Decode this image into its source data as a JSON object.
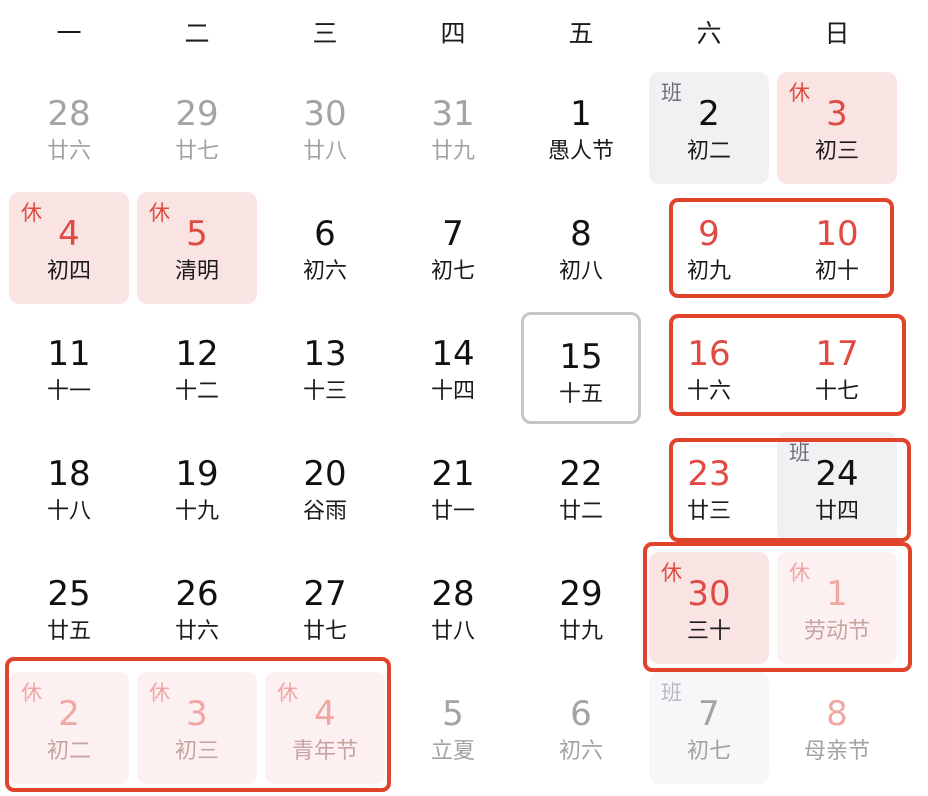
{
  "weekdays": [
    "一",
    "二",
    "三",
    "四",
    "五",
    "六",
    "日"
  ],
  "weeks": [
    [
      {
        "day": "28",
        "sub": "廿六",
        "other": true
      },
      {
        "day": "29",
        "sub": "廿七",
        "other": true
      },
      {
        "day": "30",
        "sub": "廿八",
        "other": true
      },
      {
        "day": "31",
        "sub": "廿九",
        "other": true
      },
      {
        "day": "1",
        "sub": "愚人节"
      },
      {
        "day": "2",
        "sub": "初二",
        "badge": "班",
        "type": "work"
      },
      {
        "day": "3",
        "sub": "初三",
        "badge": "休",
        "type": "rest",
        "red": true
      }
    ],
    [
      {
        "day": "4",
        "sub": "初四",
        "badge": "休",
        "type": "rest",
        "red": true
      },
      {
        "day": "5",
        "sub": "清明",
        "badge": "休",
        "type": "rest",
        "red": true
      },
      {
        "day": "6",
        "sub": "初六"
      },
      {
        "day": "7",
        "sub": "初七"
      },
      {
        "day": "8",
        "sub": "初八"
      },
      {
        "day": "9",
        "sub": "初九",
        "red": true
      },
      {
        "day": "10",
        "sub": "初十",
        "red": true
      }
    ],
    [
      {
        "day": "11",
        "sub": "十一"
      },
      {
        "day": "12",
        "sub": "十二"
      },
      {
        "day": "13",
        "sub": "十三"
      },
      {
        "day": "14",
        "sub": "十四"
      },
      {
        "day": "15",
        "sub": "十五",
        "today": true
      },
      {
        "day": "16",
        "sub": "十六",
        "red": true
      },
      {
        "day": "17",
        "sub": "十七",
        "red": true
      }
    ],
    [
      {
        "day": "18",
        "sub": "十八"
      },
      {
        "day": "19",
        "sub": "十九"
      },
      {
        "day": "20",
        "sub": "谷雨"
      },
      {
        "day": "21",
        "sub": "廿一"
      },
      {
        "day": "22",
        "sub": "廿二"
      },
      {
        "day": "23",
        "sub": "廿三",
        "red": true
      },
      {
        "day": "24",
        "sub": "廿四",
        "badge": "班",
        "type": "work"
      }
    ],
    [
      {
        "day": "25",
        "sub": "廿五"
      },
      {
        "day": "26",
        "sub": "廿六"
      },
      {
        "day": "27",
        "sub": "廿七"
      },
      {
        "day": "28",
        "sub": "廿八"
      },
      {
        "day": "29",
        "sub": "廿九"
      },
      {
        "day": "30",
        "sub": "三十",
        "badge": "休",
        "type": "rest",
        "red": true
      },
      {
        "day": "1",
        "sub": "劳动节",
        "badge": "休",
        "type": "rest",
        "red": true,
        "other": true
      }
    ],
    [
      {
        "day": "2",
        "sub": "初二",
        "badge": "休",
        "type": "rest",
        "red": true,
        "other": true
      },
      {
        "day": "3",
        "sub": "初三",
        "badge": "休",
        "type": "rest",
        "red": true,
        "other": true
      },
      {
        "day": "4",
        "sub": "青年节",
        "badge": "休",
        "type": "rest",
        "red": true,
        "other": true
      },
      {
        "day": "5",
        "sub": "立夏",
        "other": true
      },
      {
        "day": "6",
        "sub": "初六",
        "other": true
      },
      {
        "day": "7",
        "sub": "初七",
        "badge": "班",
        "type": "work",
        "other": true
      },
      {
        "day": "8",
        "sub": "母亲节",
        "red": true,
        "other": true
      }
    ]
  ],
  "colors": {
    "highlight_border": "#e0442c",
    "rest_red": "#e04a43",
    "rest_bg": "#f9e3e3",
    "work_bg": "#f1f1f4",
    "today_border": "#c5c5cb"
  }
}
